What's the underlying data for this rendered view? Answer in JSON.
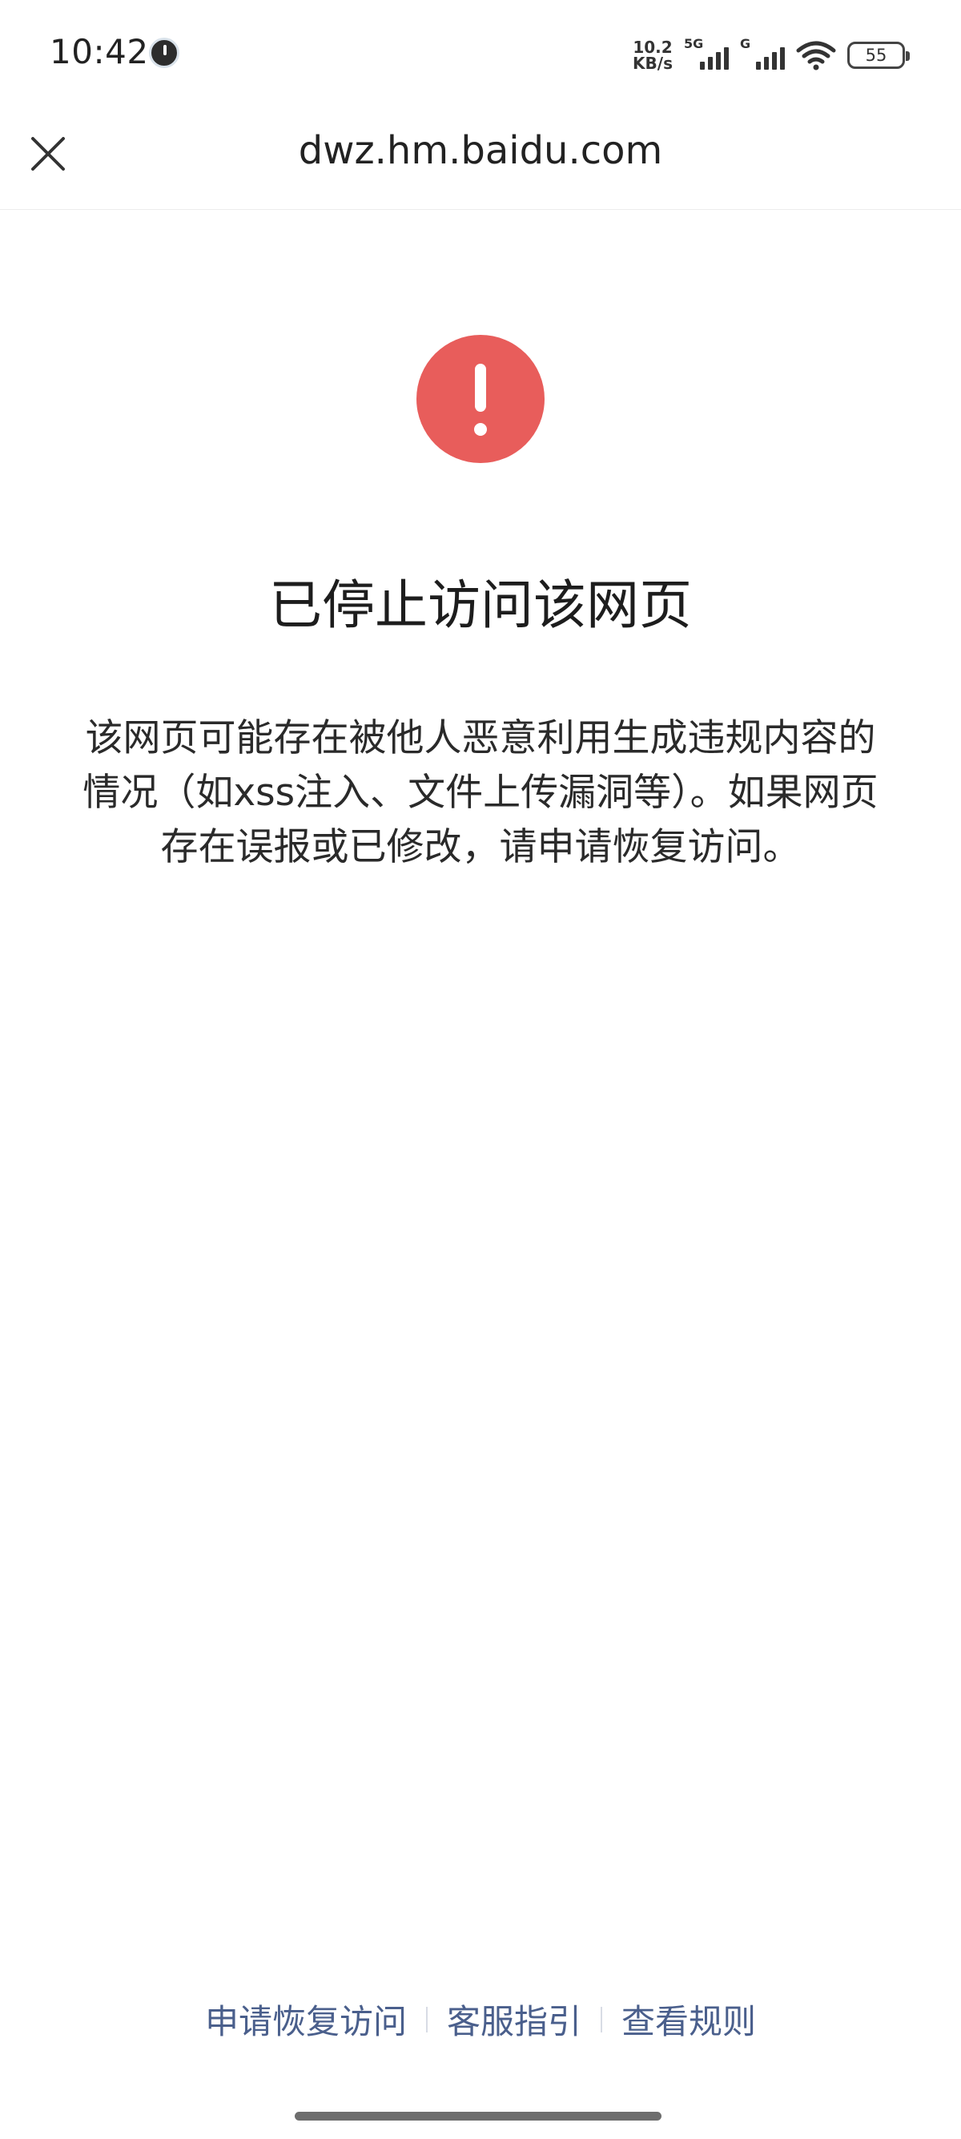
{
  "status_bar": {
    "time": "10:42",
    "net_speed_value": "10.2",
    "net_speed_unit": "KB/s",
    "sim1_label": "5G",
    "sim2_label": "G",
    "battery_level": "55"
  },
  "header": {
    "title": "dwz.hm.baidu.com",
    "close_icon": "close-icon"
  },
  "content": {
    "icon": "alert-icon",
    "icon_color": "#e85d5b",
    "title": "已停止访问该网页",
    "description": "该网页可能存在被他人恶意利用生成违规内容的情况（如xss注入、文件上传漏洞等）。如果网页存在误报或已修改，请申请恢复访问。"
  },
  "footer": {
    "links": [
      {
        "label": "申请恢复访问"
      },
      {
        "label": "客服指引"
      },
      {
        "label": "查看规则"
      }
    ],
    "link_color": "#4a5f8c"
  }
}
